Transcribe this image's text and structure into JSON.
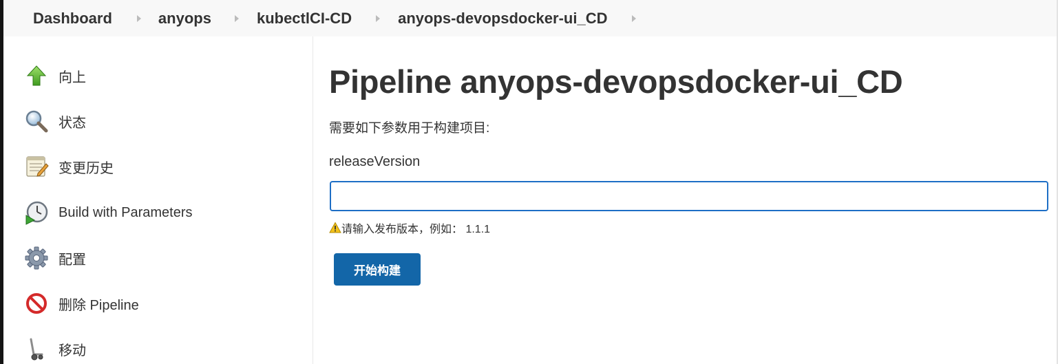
{
  "breadcrumb": {
    "items": [
      {
        "label": "Dashboard"
      },
      {
        "label": "anyops"
      },
      {
        "label": "kubectlCI-CD"
      },
      {
        "label": "anyops-devopsdocker-ui_CD"
      }
    ]
  },
  "sidebar": {
    "items": [
      {
        "label": "向上",
        "icon": "up-arrow-icon"
      },
      {
        "label": "状态",
        "icon": "magnifier-icon"
      },
      {
        "label": "变更历史",
        "icon": "notepad-icon"
      },
      {
        "label": "Build with Parameters",
        "icon": "clock-play-icon"
      },
      {
        "label": "配置",
        "icon": "gear-icon"
      },
      {
        "label": "删除 Pipeline",
        "icon": "no-entry-icon"
      },
      {
        "label": "移动",
        "icon": "hand-truck-icon"
      }
    ]
  },
  "main": {
    "title": "Pipeline anyops-devopsdocker-ui_CD",
    "description": "需要如下参数用于构建项目:",
    "parameter": {
      "name": "releaseVersion",
      "value": "",
      "hint": "请输入发布版本，例如： 1.1.1"
    },
    "build_button": "开始构建"
  },
  "colors": {
    "button_bg": "#1366a8",
    "input_border": "#1d6ec5",
    "breadcrumb_bg": "#f8f8f8",
    "text": "#333333"
  }
}
